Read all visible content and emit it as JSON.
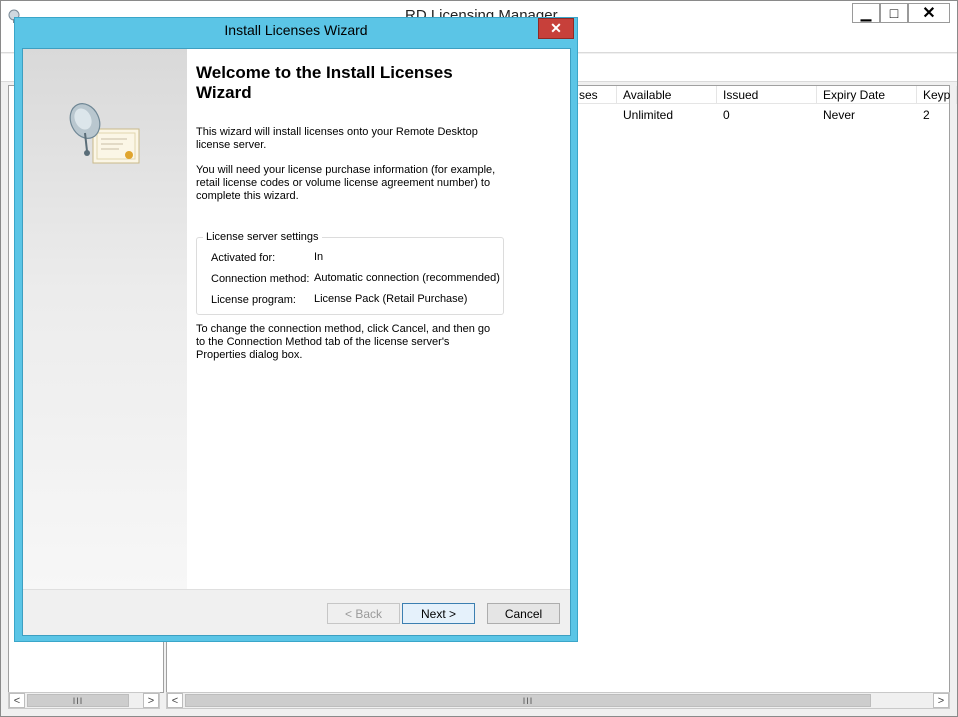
{
  "main_window": {
    "title": "RD Licensing Manager",
    "columns": [
      "ses",
      "Available",
      "Issued",
      "Expiry Date",
      "Keyp"
    ],
    "rows": [
      [
        "",
        "Unlimited",
        "0",
        "Never",
        "2"
      ]
    ],
    "min_glyph": "▁",
    "max_glyph": "□",
    "close_glyph": "✕",
    "scroll_left": "<",
    "scroll_right": ">",
    "thumb_grip": "III"
  },
  "wizard": {
    "title": "Install Licenses Wizard",
    "close_glyph": "✕",
    "heading": "Welcome to the Install Licenses Wizard",
    "para1": "This wizard will install licenses onto your Remote Desktop license server.",
    "para2": "You will need your license purchase information (for example, retail license codes or volume license agreement number) to complete this wizard.",
    "settings": {
      "legend": "License server settings",
      "activated_label": "Activated for:",
      "activated_value": "In",
      "connection_label": "Connection method:",
      "connection_value": "Automatic connection (recommended)",
      "program_label": "License program:",
      "program_value": "License Pack (Retail Purchase)"
    },
    "para3": "To change the connection method, click Cancel, and then go to the Connection Method tab of the license server's Properties dialog box.",
    "buttons": {
      "back": "< Back",
      "next": "Next >",
      "cancel": "Cancel"
    }
  },
  "icons": {
    "app": "license-manager-icon",
    "wizard": "satellite-certificate-icon"
  },
  "colors": {
    "wizard_frame": "#5bc5e6",
    "close_red": "#c7403a"
  }
}
